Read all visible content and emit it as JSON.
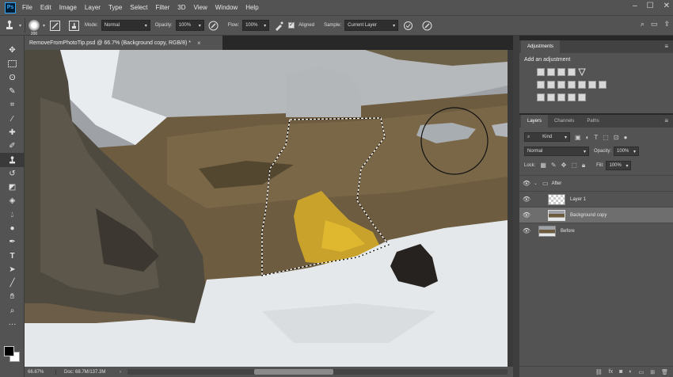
{
  "app": {
    "logo": "Ps"
  },
  "menu": [
    "File",
    "Edit",
    "Image",
    "Layer",
    "Type",
    "Select",
    "Filter",
    "3D",
    "View",
    "Window",
    "Help"
  ],
  "window_controls": [
    "–",
    "☐",
    "✕"
  ],
  "options": {
    "brush_size": "200",
    "mode_label": "Mode:",
    "mode_value": "Normal",
    "opacity_label": "Opacity:",
    "opacity_value": "100%",
    "flow_label": "Flow:",
    "flow_value": "100%",
    "aligned_label": "Aligned",
    "sample_label": "Sample:",
    "sample_value": "Current Layer"
  },
  "document": {
    "tab_title": "RemoveFromPhotoTip.psd @ 66.7% (Background copy, RGB/8) *",
    "close": "×"
  },
  "status": {
    "zoom": "66.67%",
    "doc": "Doc: 68.7M/137.3M"
  },
  "adjustments": {
    "tab": "Adjustments",
    "heading": "Add an adjustment"
  },
  "layers_panel": {
    "tabs": [
      "Layers",
      "Channels",
      "Paths"
    ],
    "kind_label": "Kind",
    "blend_mode": "Normal",
    "opacity_label": "Opacity:",
    "opacity_value": "100%",
    "lock_label": "Lock:",
    "fill_label": "Fill:",
    "fill_value": "100%",
    "layers": [
      {
        "name": "After",
        "type": "group"
      },
      {
        "name": "Layer 1",
        "type": "transparent"
      },
      {
        "name": "Background copy",
        "type": "image",
        "selected": true
      },
      {
        "name": "Before",
        "type": "image"
      }
    ]
  },
  "colors": {
    "ui_dark": "#282828",
    "ui_panel": "#535353",
    "selected_layer": "#6e6e6e",
    "accent_blue": "#31a8ff"
  }
}
